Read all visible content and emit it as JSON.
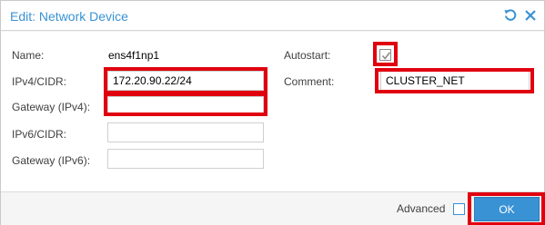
{
  "dialog": {
    "title": "Edit: Network Device",
    "tools": {
      "reset_icon": "reset-icon",
      "close_icon": "close-icon"
    }
  },
  "form": {
    "name": {
      "label": "Name:",
      "value": "ens4f1np1"
    },
    "ipv4": {
      "label": "IPv4/CIDR:",
      "value": "172.20.90.22/24"
    },
    "gateway_ipv4": {
      "label": "Gateway (IPv4):",
      "value": ""
    },
    "ipv6": {
      "label": "IPv6/CIDR:",
      "value": ""
    },
    "gateway_ipv6": {
      "label": "Gateway (IPv6):",
      "value": ""
    },
    "autostart": {
      "label": "Autostart:",
      "checked": true
    },
    "comment": {
      "label": "Comment:",
      "value": "CLUSTER_NET"
    }
  },
  "footer": {
    "advanced_label": "Advanced",
    "advanced_checked": false,
    "ok_label": "OK"
  },
  "colors": {
    "accent": "#3892d4",
    "highlight": "#e0000f"
  }
}
